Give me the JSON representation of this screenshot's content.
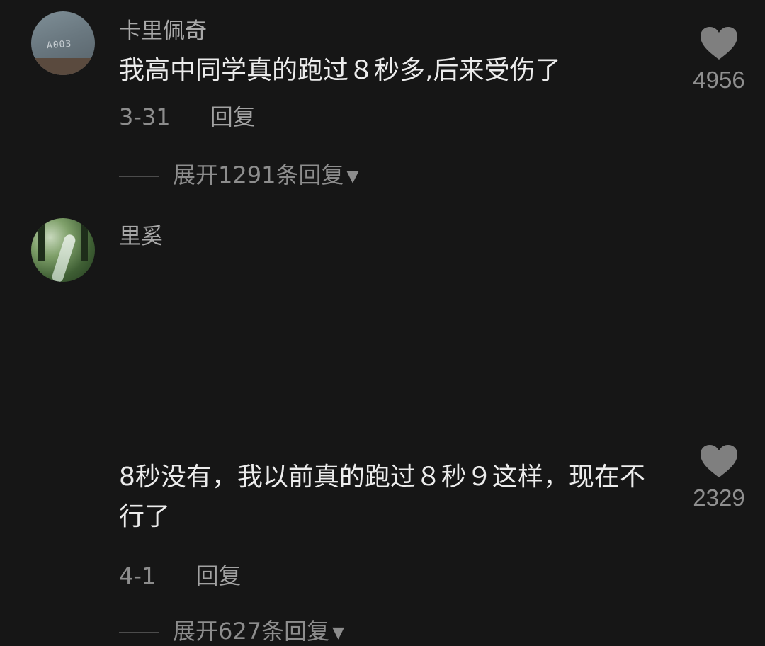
{
  "comments": [
    {
      "username": "卡里佩奇",
      "text": "我高中同学真的跑过８秒多,后来受伤了",
      "date": "3-31",
      "reply_label": "回复",
      "expand_label": "展开1291条回复",
      "like_count": "4956",
      "avatar_text": "A003"
    },
    {
      "username": "里奚",
      "text": "8秒没有，我以前真的跑过８秒９这样，现在不行了",
      "date": "4-1",
      "reply_label": "回复",
      "expand_label": "展开627条回复",
      "like_count": "2329"
    }
  ],
  "icons": {
    "like": "heart-icon",
    "expand": "caret-down-icon"
  },
  "colors": {
    "background": "#161616",
    "primary_text": "#ececec",
    "secondary_text": "#8d8d8d",
    "heart": "#7f7f7f"
  }
}
